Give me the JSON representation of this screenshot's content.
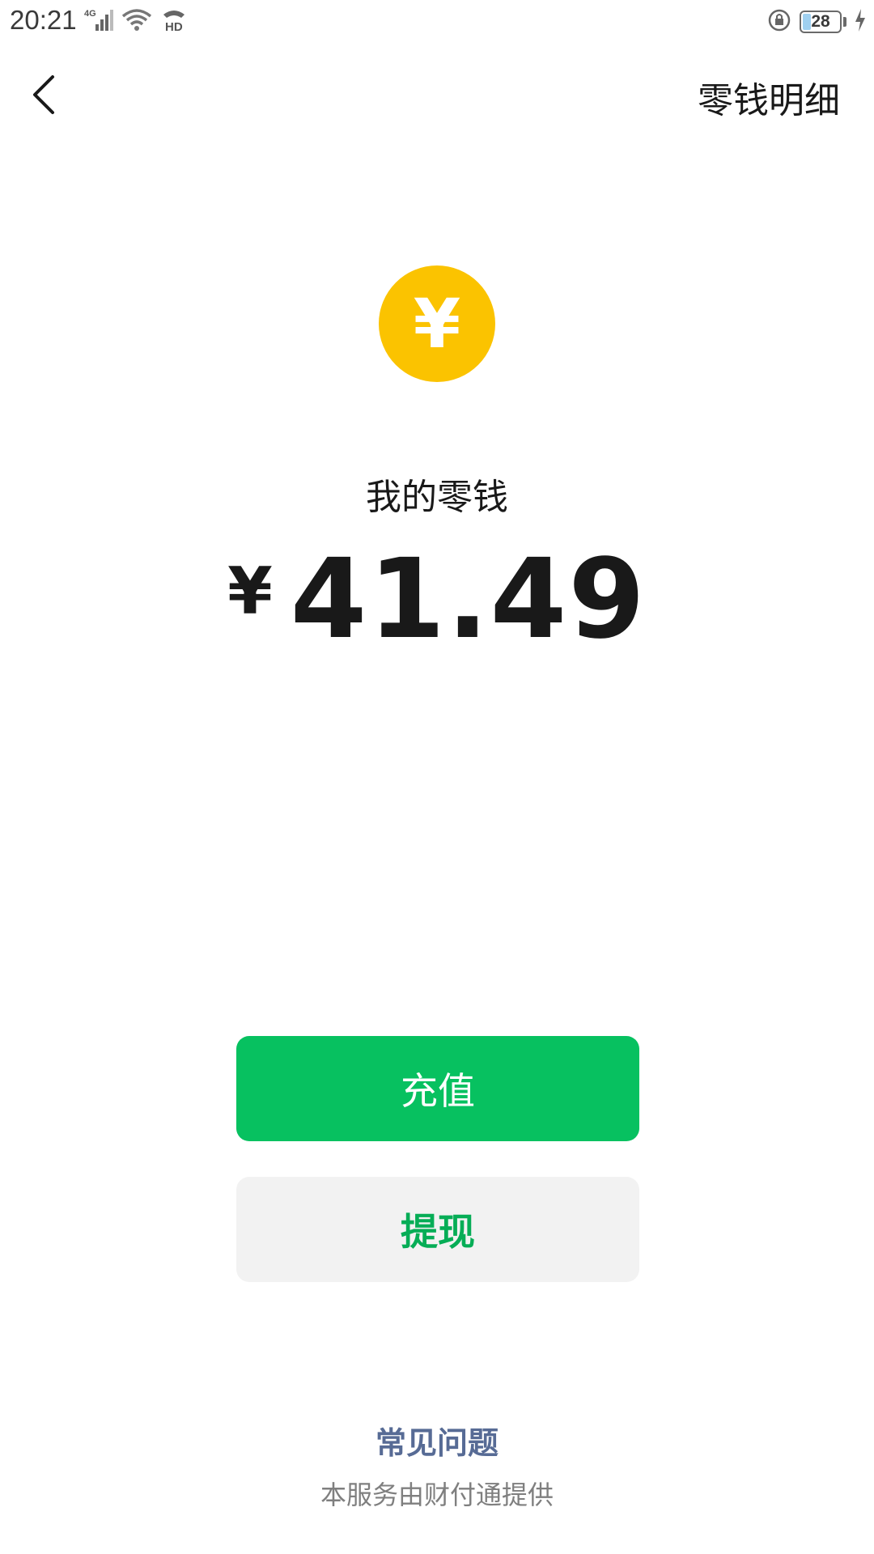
{
  "status_bar": {
    "time": "20:21",
    "network_type": "4G",
    "hd_label": "HD",
    "battery_level": "28",
    "icons": [
      "signal-icon",
      "wifi-icon",
      "hd-call-icon",
      "rotation-lock-icon",
      "battery-icon",
      "charging-icon"
    ]
  },
  "nav": {
    "back_icon": "chevron-left-icon",
    "detail_label": "零钱明细"
  },
  "wallet": {
    "coin_icon": "yuan-coin-icon",
    "coin_symbol": "¥",
    "coin_color": "#FBC300",
    "label": "我的零钱",
    "currency_symbol": "¥",
    "amount": "41.49"
  },
  "actions": {
    "recharge_label": "充值",
    "withdraw_label": "提现",
    "primary_color": "#07C160"
  },
  "footer": {
    "faq_label": "常见问题",
    "provider_note": "本服务由财付通提供"
  }
}
